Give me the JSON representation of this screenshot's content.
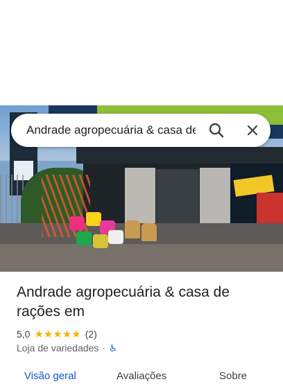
{
  "search": {
    "value": "Andrade agropecuária & casa de rações",
    "search_icon": "search-icon",
    "close_icon": "close-icon"
  },
  "photo": {
    "description_icon": "storefront-photo"
  },
  "place": {
    "title": "Andrade agropecuária & casa de rações em",
    "rating": "5,0",
    "stars": "★★★★★",
    "review_count": "(2)",
    "category": "Loja de variedades",
    "separator": "·",
    "accessibility_icon": "♿"
  },
  "tabs": [
    {
      "label": "Visão geral",
      "active": true
    },
    {
      "label": "Avaliações",
      "active": false
    },
    {
      "label": "Sobre",
      "active": false
    }
  ],
  "colors": {
    "accent": "#0b57d0",
    "star": "#f6b400",
    "access": "#1a73e8"
  }
}
